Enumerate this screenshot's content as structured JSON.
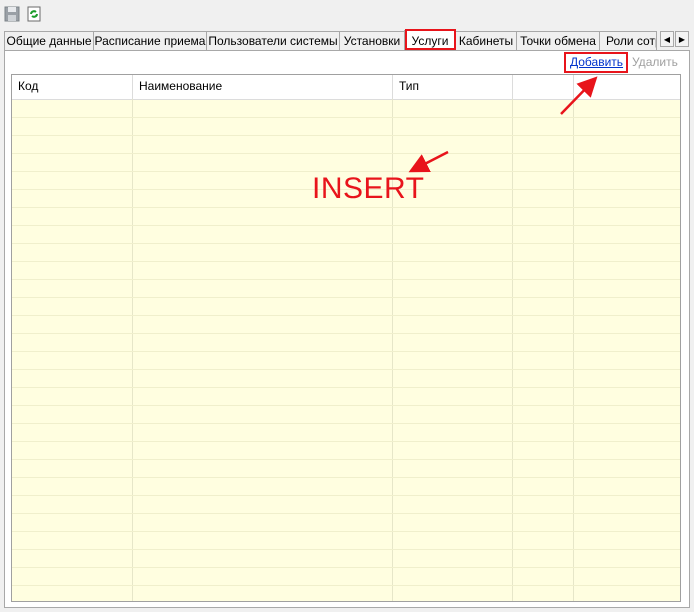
{
  "toolbar": {
    "save_icon": "save-icon",
    "refresh_icon": "refresh-icon"
  },
  "tabs": [
    {
      "label": "Общие данные"
    },
    {
      "label": "Расписание приема"
    },
    {
      "label": "Пользователи системы"
    },
    {
      "label": "Установки"
    },
    {
      "label": "Услуги",
      "active": true
    },
    {
      "label": "Кабинеты"
    },
    {
      "label": "Точки обмена"
    },
    {
      "label": "Роли сотрудников"
    }
  ],
  "actions": {
    "add_label": "Добавить",
    "delete_label": "Удалить"
  },
  "grid": {
    "columns": [
      {
        "label": "Код"
      },
      {
        "label": "Наименование"
      },
      {
        "label": "Тип"
      },
      {
        "label": ""
      },
      {
        "label": ""
      }
    ],
    "rows": []
  },
  "annotation": {
    "text": "INSERT"
  },
  "colors": {
    "annotation": "#e8141b",
    "grid_bg": "#fffee0",
    "link": "#0033cc"
  }
}
